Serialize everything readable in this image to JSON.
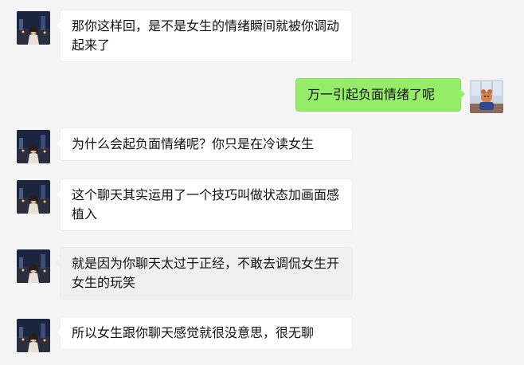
{
  "colors": {
    "background": "#f5f5f5",
    "incoming_bubble": "#ffffff",
    "outgoing_bubble": "#95ec69",
    "text": "#111111"
  },
  "messages": [
    {
      "side": "left",
      "avatar": "contact-avatar",
      "text": "那你这样回，是不是女生的情绪瞬间就被你调动起来了"
    },
    {
      "side": "right",
      "avatar": "user-avatar",
      "text": "万一引起负面情绪了呢"
    },
    {
      "side": "left",
      "avatar": "contact-avatar",
      "text": "为什么会起负面情绪呢？你只是在冷读女生"
    },
    {
      "side": "left",
      "avatar": "contact-avatar",
      "text": "这个聊天其实运用了一个技巧叫做状态加画面感植入"
    },
    {
      "side": "left",
      "avatar": "contact-avatar",
      "text": "就是因为你聊天太过于正经，不敢去调侃女生开女生的玩笑"
    },
    {
      "side": "left",
      "avatar": "contact-avatar",
      "text": "所以女生跟你聊天感觉就很没意思，很无聊"
    }
  ]
}
